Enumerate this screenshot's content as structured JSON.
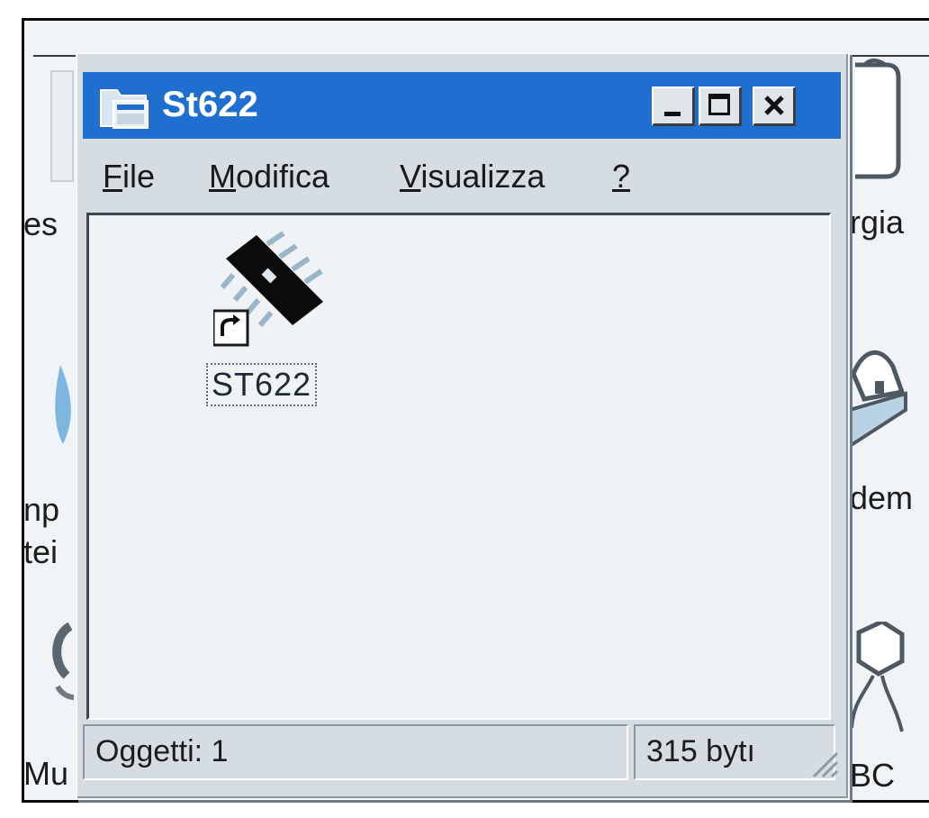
{
  "desktop": {
    "labels": {
      "left_es": "es",
      "left_np": "np",
      "left_tei": "tei",
      "left_mu": "Mu",
      "right_rgia": "rgia",
      "right_dem": "dem",
      "right_bc": "BC"
    }
  },
  "window": {
    "title": "St622",
    "icon": "folder-window-icon",
    "controls": {
      "minimize": "minimize-icon",
      "maximize": "maximize-icon",
      "close": "close-icon"
    },
    "menu": [
      {
        "accel": "F",
        "rest": "ile"
      },
      {
        "accel": "M",
        "rest": "odifica"
      },
      {
        "accel": "V",
        "rest": "isualizza"
      },
      {
        "accel": "?",
        "rest": ""
      }
    ],
    "items": [
      {
        "label": "ST622",
        "icon": "chip-shortcut-icon",
        "selected": true
      }
    ],
    "status": {
      "objects": "Oggetti: 1",
      "size": "315 bytı"
    }
  },
  "colors": {
    "titlebar": "#1e6fd0",
    "window_bg": "#d6dde2",
    "content_bg": "#f0f3f5"
  }
}
